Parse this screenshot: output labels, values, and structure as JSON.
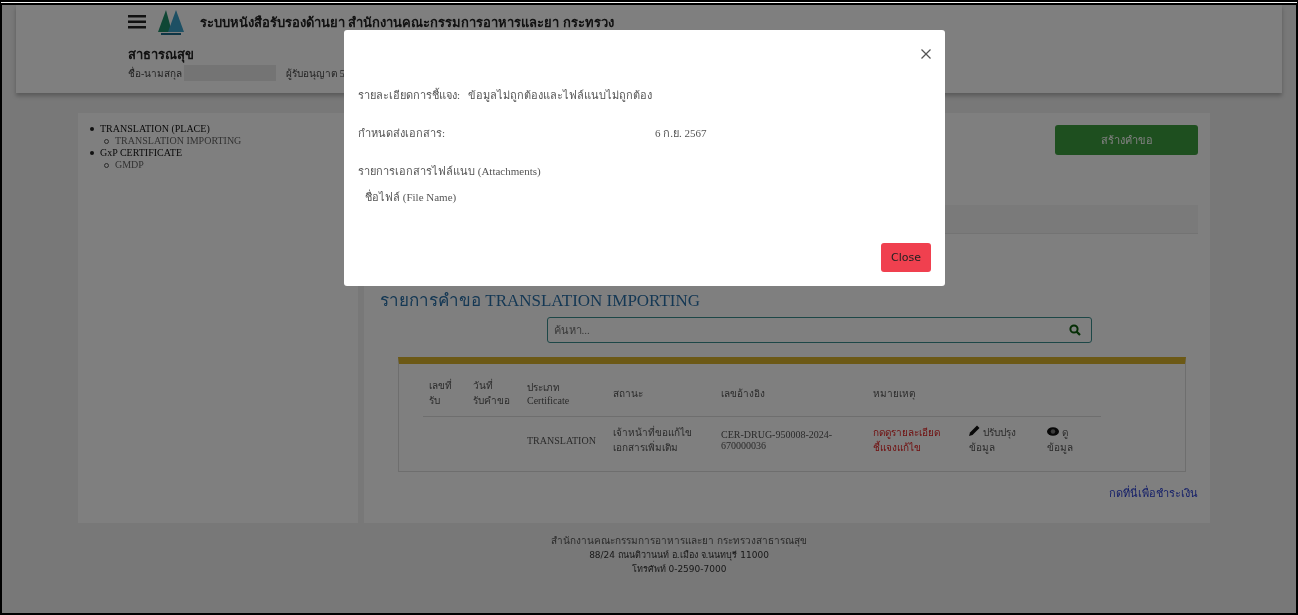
{
  "header": {
    "title": "ระบบหนังสือรับรองด้านยา สำนักงานคณะกรรมการอาหารและยา กระทรวง",
    "subtitle": "สาธารณสุข",
    "name_label": "ชื่อ-นามสกุล",
    "role": "ผู้รับอนุญาต 5"
  },
  "sidebar": {
    "items": [
      {
        "label": "TRANSLATION (PLACE)",
        "children": [
          {
            "label": "TRANSLATION IMPORTING"
          }
        ]
      },
      {
        "label": "GxP CERTIFICATE",
        "children": [
          {
            "label": "GMDP"
          }
        ]
      }
    ]
  },
  "main": {
    "create_button": "สร้างคำขอ",
    "heading": "รายการคำขอ TRANSLATION IMPORTING",
    "search": {
      "placeholder": "ค้นหา..."
    },
    "table": {
      "columns": [
        "เลขที่ รับ",
        "วันที่ รับคำขอ",
        "ประเภท Certificate",
        "สถานะ",
        "เลขอ้างอิง",
        "หมายเหตุ"
      ],
      "rows": [
        {
          "type": "TRANSLATION",
          "status": "เจ้าหน้าที่ขอแก้ไข เอกสารเพิ่มเติม",
          "reference": "CER-DRUG-950008-2024-670000036",
          "note": "กดดูรายละเอียด ชี้แจงแก้ไข",
          "actions": [
            {
              "kind": "edit",
              "label": "ปรับปรุง ข้อมูล"
            },
            {
              "kind": "view",
              "label": "ดู ข้อมูล"
            }
          ]
        }
      ]
    },
    "payment_link": "กดที่นี่เพื่อชำระเงิน"
  },
  "footer": {
    "lines": [
      "สำนักงานคณะกรรมการอาหารและยา กระทรวงสาธารณสุข",
      "88/24 ถนนติวานนท์ อ.เมือง จ.นนทบุรี 11000",
      "โทรศัพท์ 0-2590-7000"
    ]
  },
  "dialog": {
    "fields": [
      {
        "label": "รายละเอียดการชี้แจง:",
        "value": "ข้อมูลไม่ถูกต้องและไฟล์แนบไม่ถูกต้อง",
        "kind": "inline"
      },
      {
        "label": "กำหนดส่งเอกสาร:",
        "value": "6 ก.ย. 2567",
        "kind": "column"
      }
    ],
    "attachments_heading": "รายการเอกสารไฟล์แนบ (Attachments)",
    "attachments_column": "ชื่อไฟล์ (File Name)",
    "close_button": "Close"
  }
}
